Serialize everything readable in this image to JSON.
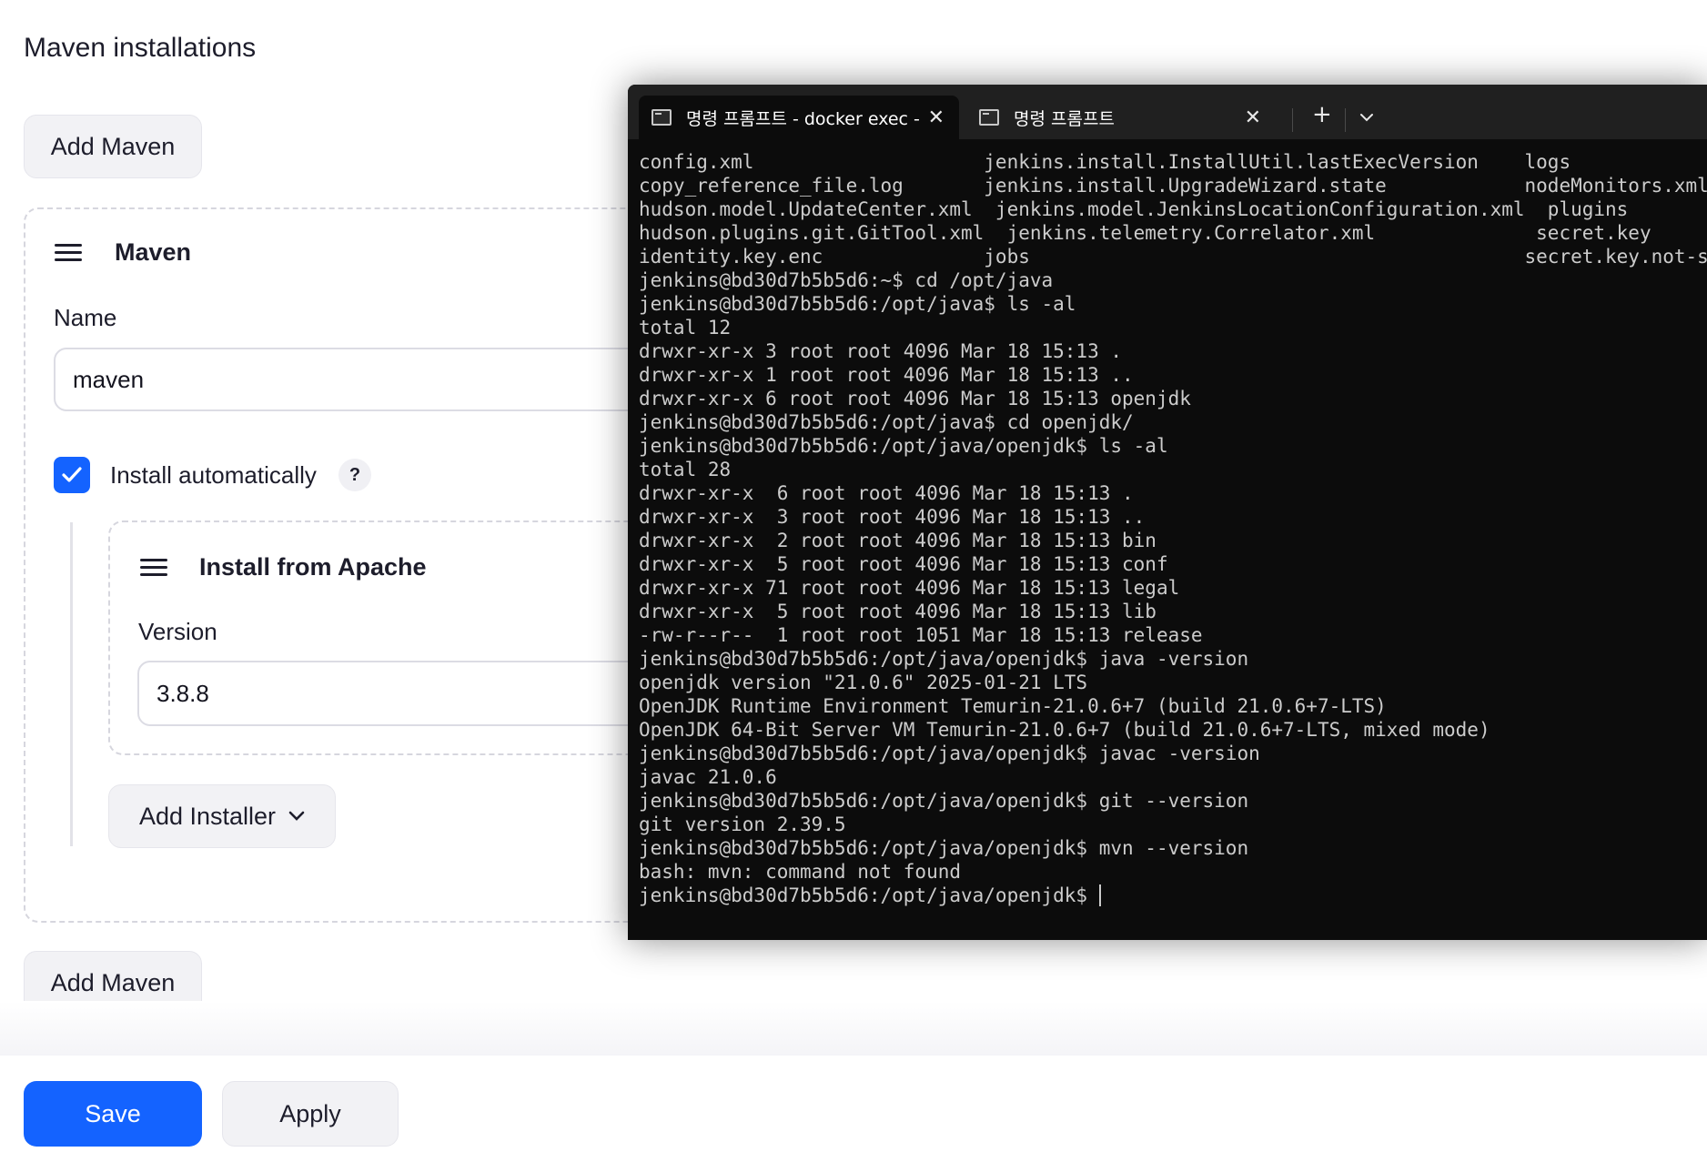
{
  "section": {
    "title": "Maven installations",
    "add_button_top": "Add Maven",
    "add_button_bottom": "Add Maven"
  },
  "maven_card": {
    "title": "Maven",
    "name_label": "Name",
    "name_value": "maven",
    "install_auto_label": "Install automatically",
    "install_auto_checked": true,
    "help_label": "?"
  },
  "installer_card": {
    "title": "Install from Apache",
    "version_label": "Version",
    "version_value": "3.8.8"
  },
  "add_installer_label": "Add Installer",
  "footer": {
    "save_label": "Save",
    "apply_label": "Apply"
  },
  "terminal": {
    "tabs": [
      {
        "label": "명령 프롬프트 - docker  exec -",
        "active": true
      },
      {
        "label": "명령 프롬프트",
        "active": false
      }
    ],
    "new_tab_label": "+",
    "dropdown_label": "⌄",
    "lines": [
      "config.xml                    jenkins.install.InstallUtil.lastExecVersion    logs",
      "copy_reference_file.log       jenkins.install.UpgradeWizard.state            nodeMonitors.xml",
      "hudson.model.UpdateCenter.xml  jenkins.model.JenkinsLocationConfiguration.xml  plugins",
      "hudson.plugins.git.GitTool.xml  jenkins.telemetry.Correlator.xml              secret.key",
      "identity.key.enc              jobs                                           secret.key.not-so-secret",
      "jenkins@bd30d7b5b5d6:~$ cd /opt/java",
      "jenkins@bd30d7b5b5d6:/opt/java$ ls -al",
      "total 12",
      "drwxr-xr-x 3 root root 4096 Mar 18 15:13 .",
      "drwxr-xr-x 1 root root 4096 Mar 18 15:13 ..",
      "drwxr-xr-x 6 root root 4096 Mar 18 15:13 openjdk",
      "jenkins@bd30d7b5b5d6:/opt/java$ cd openjdk/",
      "jenkins@bd30d7b5b5d6:/opt/java/openjdk$ ls -al",
      "total 28",
      "drwxr-xr-x  6 root root 4096 Mar 18 15:13 .",
      "drwxr-xr-x  3 root root 4096 Mar 18 15:13 ..",
      "drwxr-xr-x  2 root root 4096 Mar 18 15:13 bin",
      "drwxr-xr-x  5 root root 4096 Mar 18 15:13 conf",
      "drwxr-xr-x 71 root root 4096 Mar 18 15:13 legal",
      "drwxr-xr-x  5 root root 4096 Mar 18 15:13 lib",
      "-rw-r--r--  1 root root 1051 Mar 18 15:13 release",
      "jenkins@bd30d7b5b5d6:/opt/java/openjdk$ java -version",
      "openjdk version \"21.0.6\" 2025-01-21 LTS",
      "OpenJDK Runtime Environment Temurin-21.0.6+7 (build 21.0.6+7-LTS)",
      "OpenJDK 64-Bit Server VM Temurin-21.0.6+7 (build 21.0.6+7-LTS, mixed mode)",
      "jenkins@bd30d7b5b5d6:/opt/java/openjdk$ javac -version",
      "javac 21.0.6",
      "jenkins@bd30d7b5b5d6:/opt/java/openjdk$ git --version",
      "git version 2.39.5",
      "jenkins@bd30d7b5b5d6:/opt/java/openjdk$ mvn --version",
      "bash: mvn: command not found"
    ],
    "prompt": "jenkins@bd30d7b5b5d6:/opt/java/openjdk$ "
  },
  "colors": {
    "accent": "#1463ff",
    "terminal_bg": "#0c0c0c",
    "terminal_fg": "#cccccc"
  }
}
